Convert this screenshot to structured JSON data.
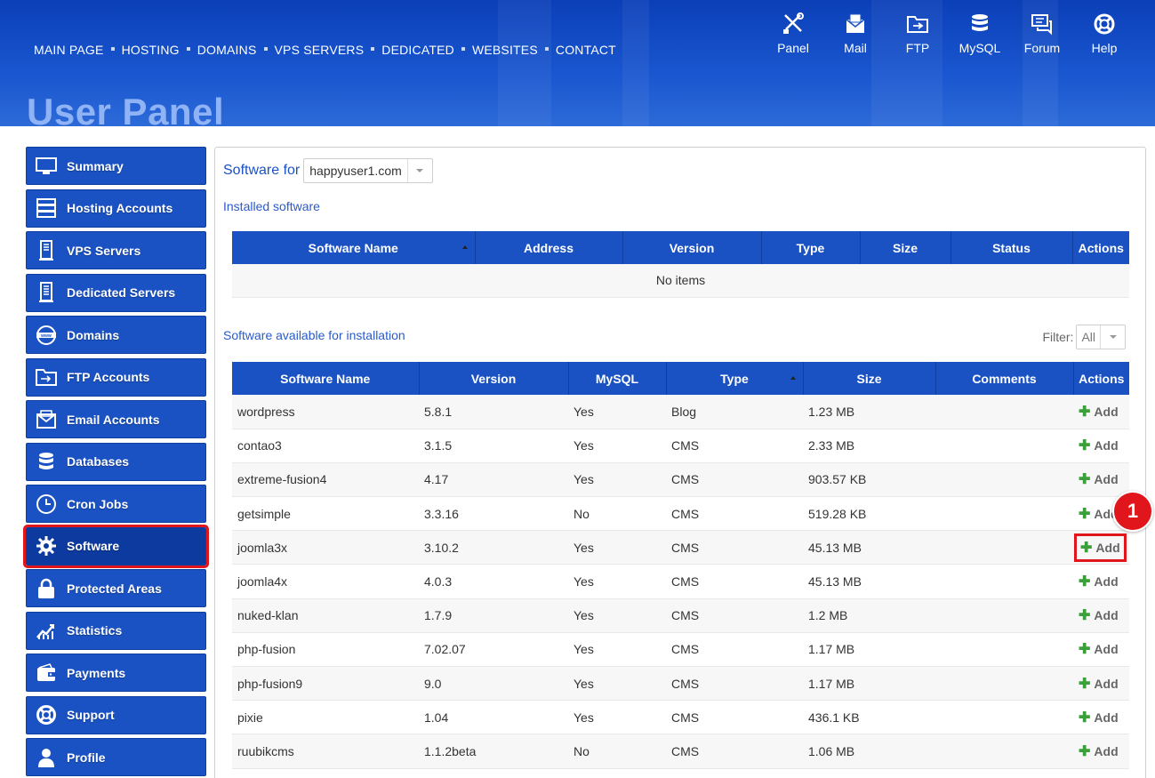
{
  "header": {
    "nav": [
      "MAIN PAGE",
      "HOSTING",
      "DOMAINS",
      "VPS SERVERS",
      "DEDICATED",
      "WEBSITES",
      "CONTACT"
    ],
    "icon_nav": [
      {
        "label": "Panel",
        "icon": "tools-icon"
      },
      {
        "label": "Mail",
        "icon": "mail-icon"
      },
      {
        "label": "FTP",
        "icon": "folder-icon"
      },
      {
        "label": "MySQL",
        "icon": "database-icon"
      },
      {
        "label": "Forum",
        "icon": "chat-icon"
      },
      {
        "label": "Help",
        "icon": "lifebuoy-icon"
      }
    ],
    "title": "User Panel"
  },
  "sidebar": {
    "items": [
      {
        "label": "Summary",
        "icon": "monitor-icon"
      },
      {
        "label": "Hosting Accounts",
        "icon": "server-icon"
      },
      {
        "label": "VPS Servers",
        "icon": "vps-icon"
      },
      {
        "label": "Dedicated Servers",
        "icon": "dedicated-icon"
      },
      {
        "label": "Domains",
        "icon": "www-icon"
      },
      {
        "label": "FTP Accounts",
        "icon": "folder-icon"
      },
      {
        "label": "Email Accounts",
        "icon": "mail-icon"
      },
      {
        "label": "Databases",
        "icon": "database-icon"
      },
      {
        "label": "Cron Jobs",
        "icon": "clock-icon"
      },
      {
        "label": "Software",
        "icon": "gear-icon"
      },
      {
        "label": "Protected Areas",
        "icon": "lock-icon"
      },
      {
        "label": "Statistics",
        "icon": "chart-icon"
      },
      {
        "label": "Payments",
        "icon": "wallet-icon"
      },
      {
        "label": "Support",
        "icon": "lifebuoy-icon"
      },
      {
        "label": "Profile",
        "icon": "user-icon"
      }
    ],
    "active": "Software"
  },
  "main": {
    "software_for_label": "Software for",
    "domain_select": "happyuser1.com",
    "installed_label": "Installed software",
    "installed_columns": [
      "Software Name",
      "Address",
      "Version",
      "Type",
      "Size",
      "Status",
      "Actions"
    ],
    "installed_empty": "No items",
    "available_label": "Software available for installation",
    "filter_label": "Filter:",
    "filter_value": "All",
    "available_columns": [
      "Software Name",
      "Version",
      "MySQL",
      "Type",
      "Size",
      "Comments",
      "Actions"
    ],
    "add_label": "Add",
    "rows": [
      {
        "name": "wordpress",
        "version": "5.8.1",
        "mysql": "Yes",
        "type": "Blog",
        "size": "1.23 MB"
      },
      {
        "name": "contao3",
        "version": "3.1.5",
        "mysql": "Yes",
        "type": "CMS",
        "size": "2.33 MB"
      },
      {
        "name": "extreme-fusion4",
        "version": "4.17",
        "mysql": "Yes",
        "type": "CMS",
        "size": "903.57 KB"
      },
      {
        "name": "getsimple",
        "version": "3.3.16",
        "mysql": "No",
        "type": "CMS",
        "size": "519.28 KB"
      },
      {
        "name": "joomla3x",
        "version": "3.10.2",
        "mysql": "Yes",
        "type": "CMS",
        "size": "45.13 MB"
      },
      {
        "name": "joomla4x",
        "version": "4.0.3",
        "mysql": "Yes",
        "type": "CMS",
        "size": "45.13 MB"
      },
      {
        "name": "nuked-klan",
        "version": "1.7.9",
        "mysql": "Yes",
        "type": "CMS",
        "size": "1.2 MB"
      },
      {
        "name": "php-fusion",
        "version": "7.02.07",
        "mysql": "Yes",
        "type": "CMS",
        "size": "1.17 MB"
      },
      {
        "name": "php-fusion9",
        "version": "9.0",
        "mysql": "Yes",
        "type": "CMS",
        "size": "1.17 MB"
      },
      {
        "name": "pixie",
        "version": "1.04",
        "mysql": "Yes",
        "type": "CMS",
        "size": "436.1 KB"
      },
      {
        "name": "ruubikcms",
        "version": "1.1.2beta",
        "mysql": "No",
        "type": "CMS",
        "size": "1.06 MB"
      }
    ],
    "highlighted_row": "joomla3x"
  },
  "annotation": {
    "badge": "1"
  },
  "colors": {
    "primary": "#1a52c4",
    "highlight": "#e0161c",
    "add_green": "#3aa13a",
    "title": "#8fb3f5"
  }
}
